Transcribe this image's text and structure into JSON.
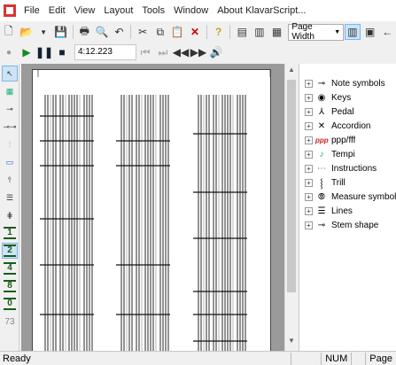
{
  "menu": [
    "File",
    "Edit",
    "View",
    "Layout",
    "Tools",
    "Window",
    "About KlavarScript..."
  ],
  "toolbar": {
    "zoom_value": "Page Width",
    "time_value": "4:12.223"
  },
  "left_panel": {
    "fingers": [
      "1",
      "2",
      "4",
      "8",
      "0"
    ],
    "count": "73"
  },
  "tree": [
    {
      "icon": "note-symbols-icon",
      "label": "Note symbols"
    },
    {
      "icon": "keys-icon",
      "label": "Keys"
    },
    {
      "icon": "pedal-icon",
      "label": "Pedal"
    },
    {
      "icon": "accordion-icon",
      "label": "Accordion"
    },
    {
      "icon": "dynamics-icon",
      "label": "ppp/fff"
    },
    {
      "icon": "tempi-icon",
      "label": "Tempi"
    },
    {
      "icon": "instructions-icon",
      "label": "Instructions"
    },
    {
      "icon": "trill-icon",
      "label": "Trill"
    },
    {
      "icon": "measure-symbols-icon",
      "label": "Measure symbols"
    },
    {
      "icon": "lines-icon",
      "label": "Lines"
    },
    {
      "icon": "stem-shape-icon",
      "label": "Stem shape"
    }
  ],
  "status": {
    "text": "Ready",
    "num": "NUM",
    "page": "Page"
  },
  "colors": {
    "accent": "#1a5c1a",
    "selection": "#cce4f7"
  }
}
